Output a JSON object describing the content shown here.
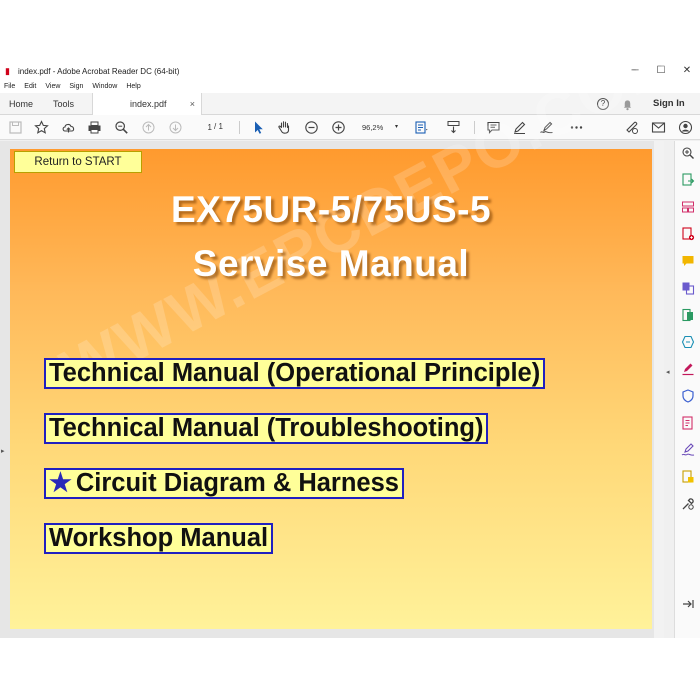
{
  "window": {
    "title": "index.pdf - Adobe Acrobat Reader DC (64-bit)",
    "minimize": "─",
    "maximize": "☐",
    "close": "✕"
  },
  "menu": [
    "File",
    "Edit",
    "View",
    "Sign",
    "Window",
    "Help"
  ],
  "tabs": {
    "home": "Home",
    "tools": "Tools",
    "document": "index.pdf",
    "close": "×",
    "help": "?",
    "sign_in": "Sign In"
  },
  "toolbar": {
    "page_current": "1",
    "page_total": "/ 1",
    "zoom": "96,2%",
    "zoom_dropdown": "▾"
  },
  "document": {
    "return_button": "Return to START",
    "title_line1": "EX75UR-5/75US-5",
    "title_line2": "Servise Manual",
    "watermark": "WWW.EPCDEPO.COM",
    "links": [
      {
        "label": "Technical Manual (Operational Principle)"
      },
      {
        "label": "Technical Manual (Troubleshooting)"
      },
      {
        "label": "Circuit Diagram & Harness",
        "star": "★"
      },
      {
        "label": "Workshop Manual"
      }
    ]
  },
  "colors": {
    "accent_blue": "#2020c0",
    "link_bg": "#ffff99",
    "adobe_red": "#d0021b"
  },
  "icons": {
    "toolbar": [
      "save-icon",
      "bookmark-star-icon",
      "upload-cloud-icon",
      "print-icon",
      "zoom-search-icon",
      "page-up-icon",
      "page-down-icon",
      "select-cursor-icon",
      "hand-icon",
      "zoom-out-icon",
      "zoom-in-icon",
      "fit-page-icon",
      "scroll-mode-icon",
      "comment-icon",
      "highlight-pen-icon",
      "sign-icon",
      "more-icon",
      "share-link-icon",
      "email-icon",
      "account-icon"
    ],
    "right_pane": [
      "search-zoom-icon",
      "export-pdf-icon",
      "organize-pages-icon",
      "create-pdf-icon",
      "comment-icon",
      "combine-files-icon",
      "edit-pdf-icon",
      "enhance-scans-icon",
      "fill-sign-icon",
      "protect-icon",
      "send-for-review-icon",
      "request-signature-icon",
      "more-tools-icon",
      "tools-icon",
      "collapse-pane-icon"
    ]
  }
}
